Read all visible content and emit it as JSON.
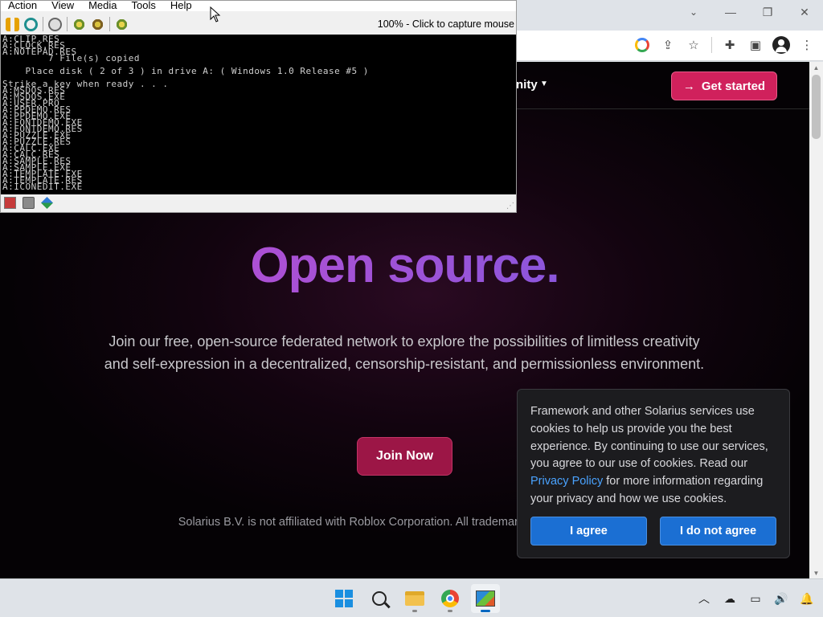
{
  "browser": {
    "window_controls": {
      "minimize": "—",
      "restore": "❐",
      "close": "✕"
    },
    "tab_dropdown_icon": "chevron-down-icon",
    "toolbar_icons": [
      "google-icon",
      "share-icon",
      "star-icon",
      "extensions-icon",
      "sidebar-icon",
      "profile-icon",
      "menu-icon"
    ]
  },
  "site": {
    "nav_community": "nity",
    "get_started": "Get started",
    "get_started_arrow": "→",
    "hero_title": "Open source.",
    "hero_subtitle": "Join our free, open-source federated network to explore the possibilities of limitless creativity and self-expression in a decentralized, censorship-resistant, and permissionless environment.",
    "join_button": "Join Now",
    "disclaimer": "Solarius B.V. is not affiliated with Roblox Corporation. All trademar… respective owners."
  },
  "cookie": {
    "text_before": "Framework and other Solarius services use cookies to help us provide you the best experience. By continuing to use our services, you agree to our use of cookies. Read our ",
    "link": "Privacy Policy",
    "text_after": " for more information regarding your privacy and how we use cookies.",
    "agree": "I agree",
    "disagree": "I do not agree"
  },
  "vm": {
    "menu": [
      "Action",
      "View",
      "Media",
      "Tools",
      "Help"
    ],
    "status": "100% - Click to capture mouse",
    "console_lines": [
      "A:CLIP.RES",
      "A:CLOCK.RES",
      "A:NOTEPAD.RES",
      "        7 File(s) copied",
      "",
      "    Place disk ( 2 of 3 ) in drive A: ( Windows 1.0 Release #5 )",
      "",
      "Strike a key when ready . . .",
      "A:MSDOS.RES",
      "A:MSDOS.EXE",
      "A:USER.PRO",
      "A:PPDEMO.RES",
      "A:PPDEMO.EXE",
      "A:FONTDEMO.EXE",
      "A:FONTDEMO.RES",
      "A:PUZZLE.EXE",
      "A:PUZZLE.RES",
      "A:CALC.EXE",
      "A:CALC.RES",
      "A:SAMPLE.RES",
      "A:SAMPLE.EXE",
      "A:TEMPLATE.EXE",
      "A:TEMPLATE.RES",
      "A:ICONEDIT.EXE"
    ]
  },
  "taskbar": {
    "apps": [
      "windows-start-icon",
      "search-icon",
      "file-explorer-icon",
      "chrome-icon",
      "vm-app-icon"
    ],
    "tray": {
      "chevron": "︿",
      "volume": "🔊"
    }
  }
}
